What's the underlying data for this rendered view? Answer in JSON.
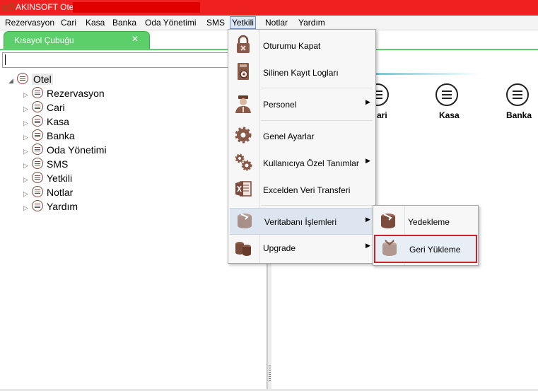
{
  "window": {
    "title": "AKINSOFT Otel"
  },
  "menubar": [
    "Rezervasyon",
    "Cari",
    "Kasa",
    "Banka",
    "Oda Yönetimi",
    "SMS",
    "Yetkili",
    "Notlar",
    "Yardım"
  ],
  "active_menu": "Yetkili",
  "tab": {
    "label": "Kısayol Çubuğu",
    "close": "✕"
  },
  "search": {
    "value": ""
  },
  "tree": {
    "root": "Otel",
    "children": [
      "Rezervasyon",
      "Cari",
      "Kasa",
      "Banka",
      "Oda Yönetimi",
      "SMS",
      "Yetkili",
      "Notlar",
      "Yardım"
    ]
  },
  "shortcuts": [
    "ari",
    "Kasa",
    "Banka"
  ],
  "dropdown": {
    "items": [
      {
        "label": "Oturumu Kapat",
        "icon": "lock-icon"
      },
      {
        "label": "Silinen Kayıt Logları",
        "icon": "log-book-icon"
      },
      {
        "label": "Personel",
        "icon": "staff-icon",
        "submenu": true
      },
      {
        "label": "Genel Ayarlar",
        "icon": "gear-icon"
      },
      {
        "label": "Kullanıcıya Özel Tanımlar",
        "icon": "gears-icon",
        "submenu": true
      },
      {
        "label": "Excelden Veri Transferi",
        "icon": "excel-icon"
      },
      {
        "label": "Veritabanı İşlemleri",
        "icon": "database-icon",
        "submenu": true
      },
      {
        "label": "Upgrade",
        "icon": "database-stack-icon",
        "submenu": true
      }
    ]
  },
  "submenu": {
    "items": [
      {
        "label": "Yedekleme",
        "icon": "backup-database-icon"
      },
      {
        "label": "Geri Yükleme",
        "icon": "restore-database-icon"
      }
    ]
  },
  "colors": {
    "titlebar": "#ee2020",
    "tab": "#5bd06a",
    "highlight_border": "#d0202a",
    "icon_brown": "#7a4a3a"
  }
}
